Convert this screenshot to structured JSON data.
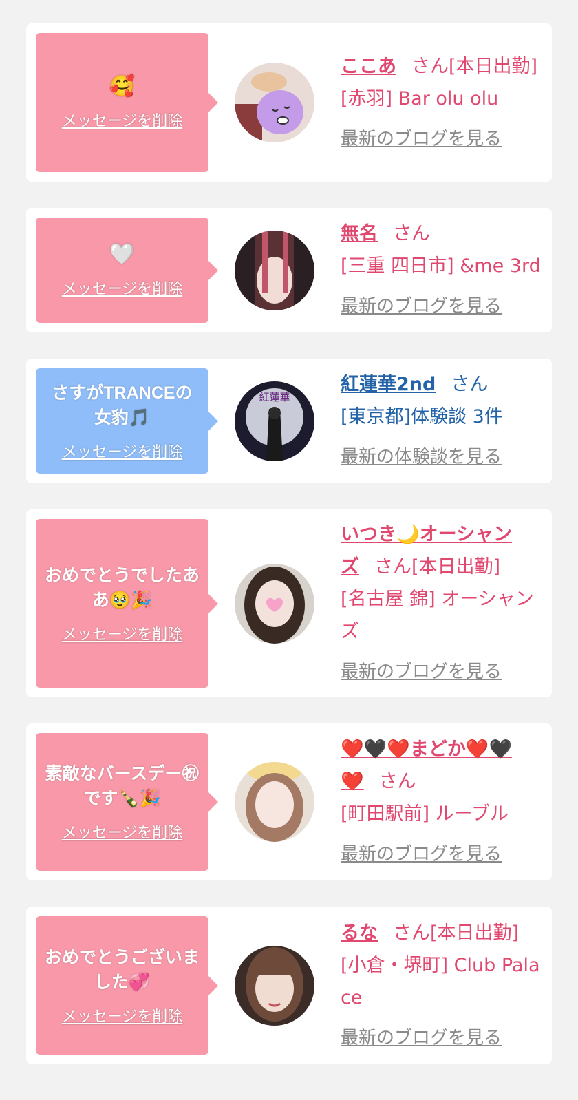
{
  "delete_label": "メッセージを削除",
  "cards": [
    {
      "message": "🥰",
      "message_color": "pink",
      "name": "ここあ",
      "suffix": "さん[本日出勤]",
      "shop": "[赤羽] Bar olu olu",
      "link": "最新のブログを見る"
    },
    {
      "message": "🤍",
      "message_color": "pink",
      "name": "無名",
      "suffix": "さん",
      "shop": "[三重 四日市] &me 3rd",
      "link": "最新のブログを見る"
    },
    {
      "message": "さすがTRANCEの女豹🎵",
      "message_color": "blue",
      "name": "紅蓮華2nd",
      "suffix": "さん",
      "shop": "[東京都]体験談 3件",
      "link": "最新の体験談を見る",
      "avatar_text": "紅蓮華"
    },
    {
      "message": "おめでとうでしたああ🥹🎉",
      "message_color": "pink",
      "name": "いつき🌙オーシャンズ",
      "suffix": "さん[本日出勤]",
      "shop": "[名古屋 錦] オーシャンズ",
      "link": "最新のブログを見る"
    },
    {
      "message": "素敵なバースデー㊗です🍾🎉",
      "message_color": "pink",
      "name": "❤️🖤❤️まどか❤️🖤❤️",
      "suffix": "さん",
      "shop": "[町田駅前] ルーブル",
      "link": "最新のブログを見る"
    },
    {
      "message": "おめでとうございました💞",
      "message_color": "pink",
      "name": "るな",
      "suffix": "さん[本日出勤]",
      "shop": "[小倉・堺町] Club Palace",
      "link": "最新のブログを見る"
    }
  ],
  "colors": {
    "pink_bubble": "#f898a8",
    "blue_bubble": "#8fbdf9",
    "pink_text": "#e0486f",
    "blue_text": "#2463a8",
    "link_gray": "#8a8a8a",
    "page_bg": "#f2f2f2"
  }
}
